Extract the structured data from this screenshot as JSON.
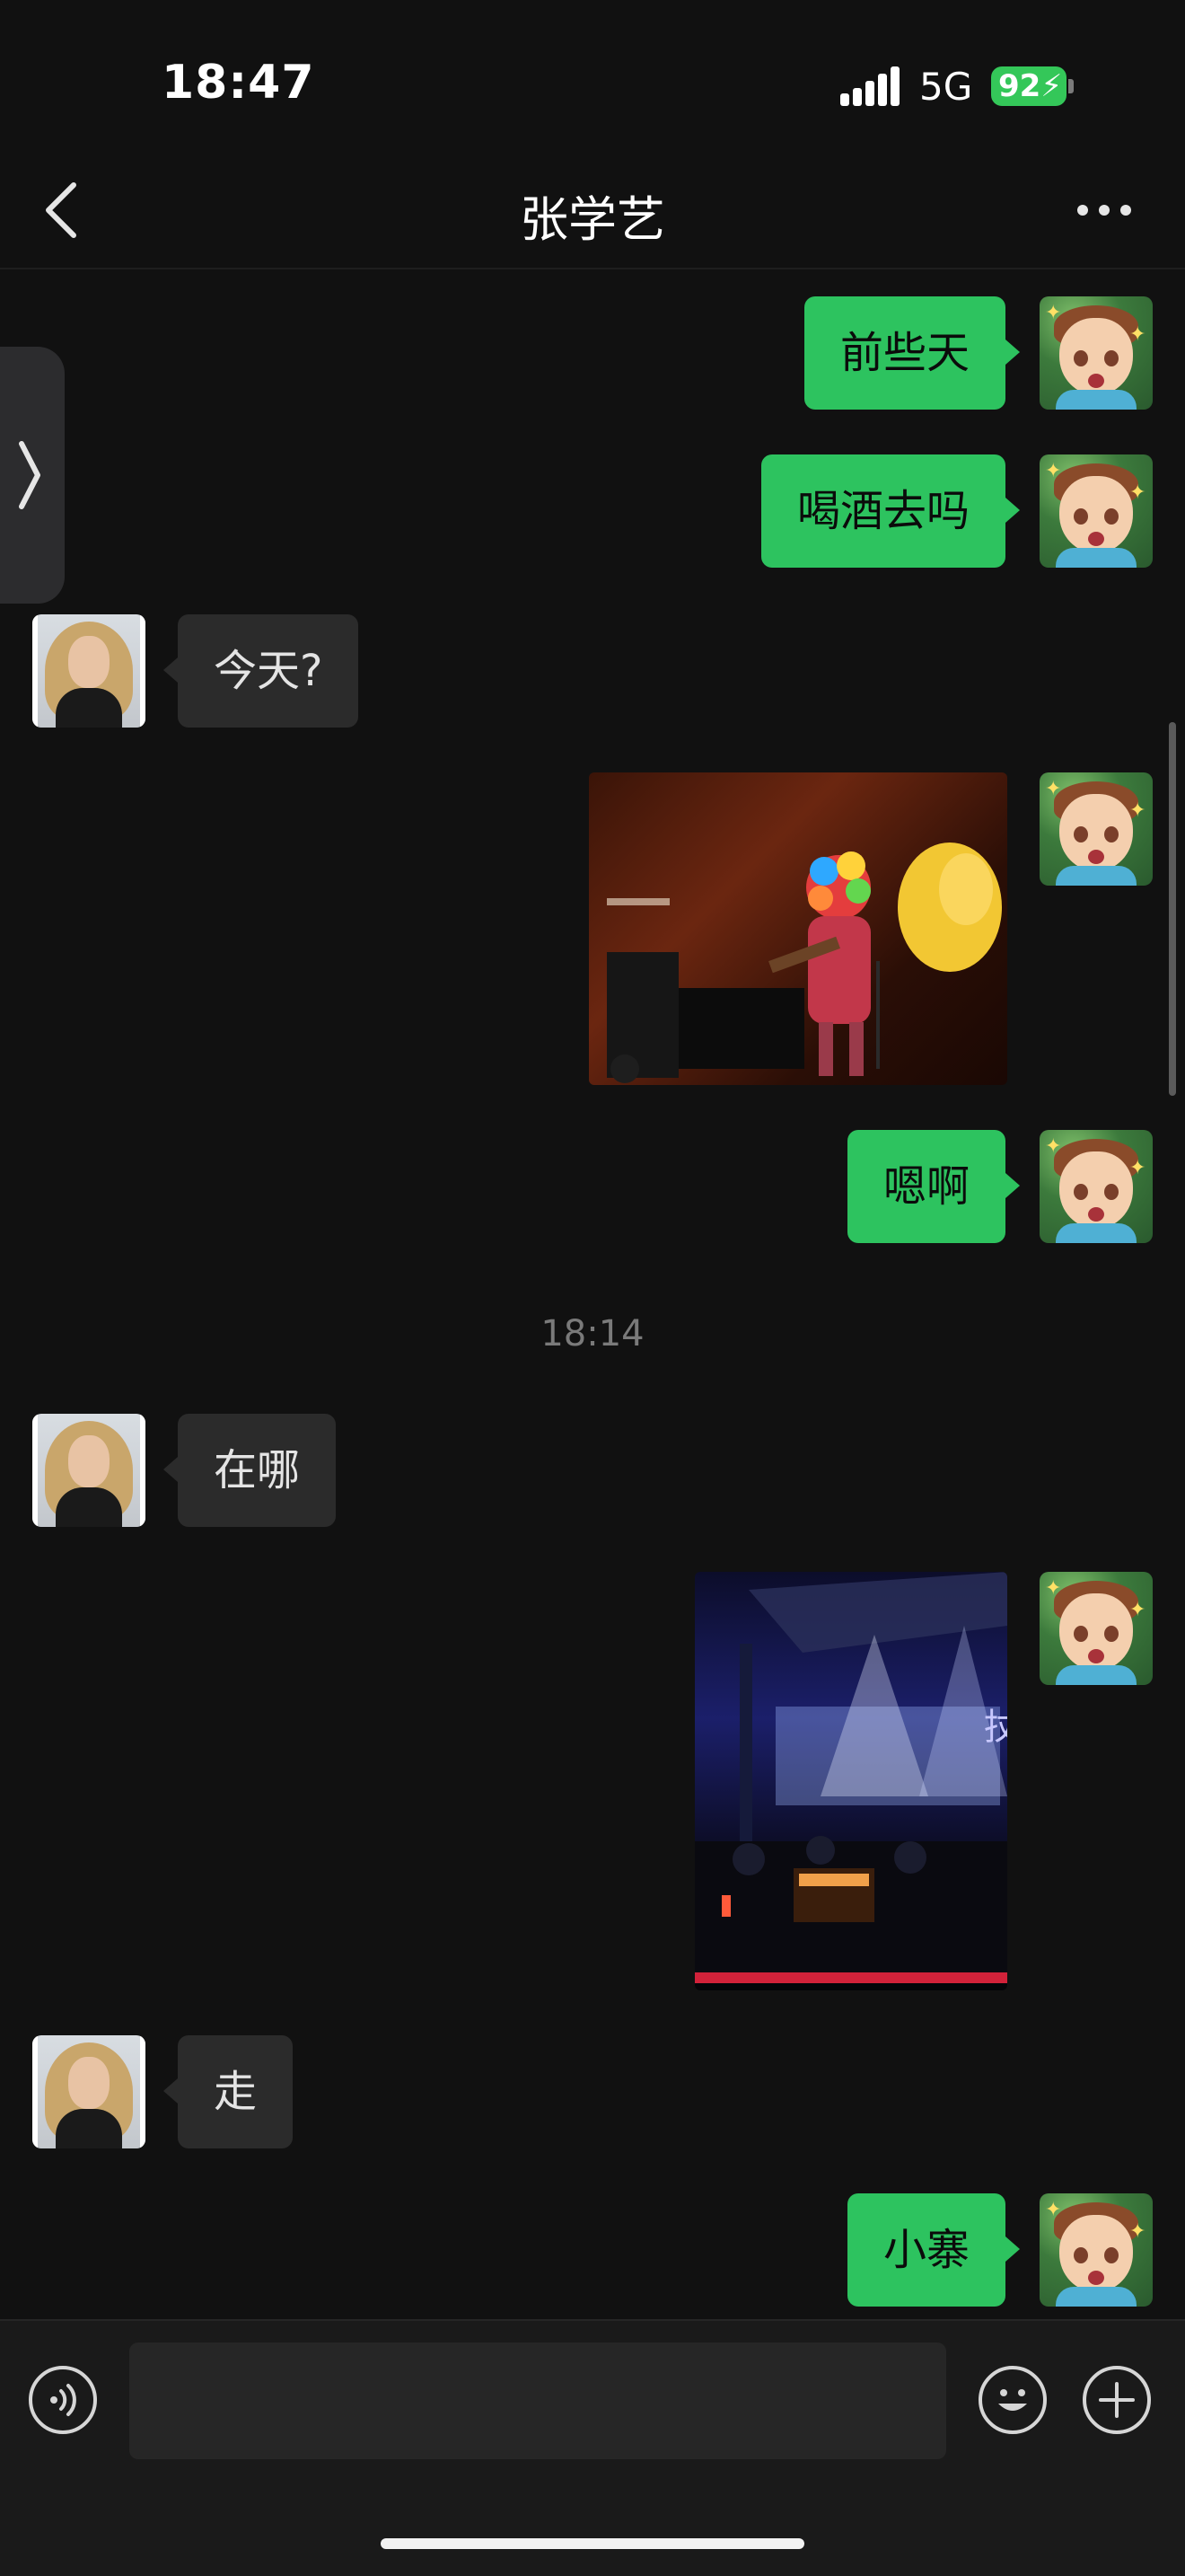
{
  "status_bar": {
    "time": "18:47",
    "network": "5G",
    "battery": "92"
  },
  "nav": {
    "title": "张学艺",
    "back_icon": "chevron-left-icon",
    "more_icon": "more-dots-icon"
  },
  "messages": [
    {
      "type": "text",
      "side": "out",
      "text": "前些天"
    },
    {
      "type": "text",
      "side": "out",
      "text": "喝酒去吗"
    },
    {
      "type": "text",
      "side": "in",
      "text": "今天?"
    },
    {
      "type": "image",
      "side": "out"
    },
    {
      "type": "text",
      "side": "out",
      "text": "嗯啊"
    },
    {
      "type": "time",
      "text": "18:14"
    },
    {
      "type": "text",
      "side": "in",
      "text": "在哪"
    },
    {
      "type": "image",
      "side": "out"
    },
    {
      "type": "text",
      "side": "in",
      "text": "走"
    },
    {
      "type": "text",
      "side": "out",
      "text": "小寨"
    }
  ],
  "input_bar": {
    "voice_icon": "voice-icon",
    "emoji_icon": "emoji-icon",
    "plus_icon": "plus-icon",
    "value": ""
  },
  "colors": {
    "outgoing_bubble": "#2dc35f",
    "incoming_bubble": "#2b2b2b",
    "background": "#111111",
    "battery": "#34c759"
  }
}
